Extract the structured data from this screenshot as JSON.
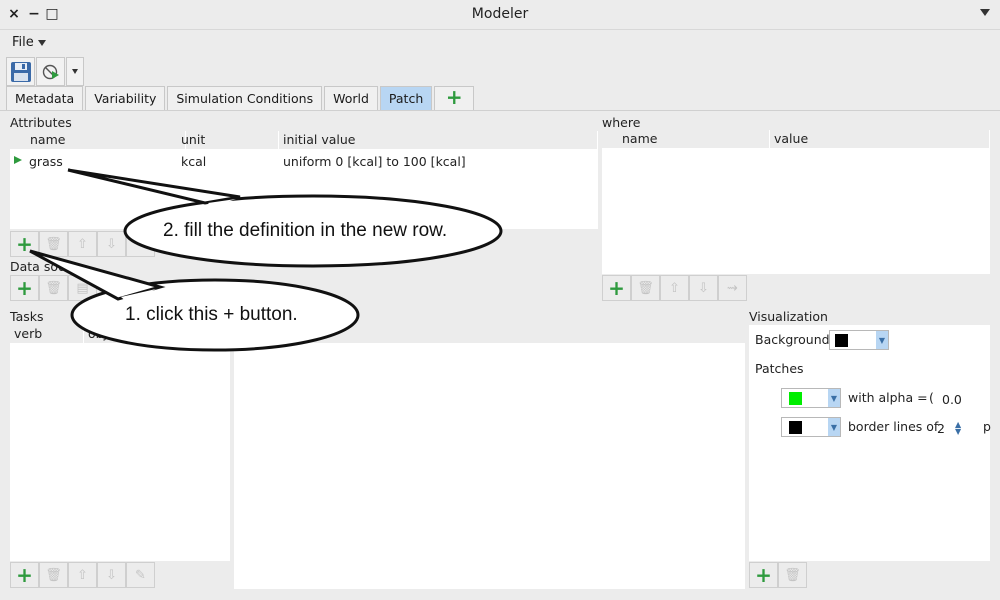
{
  "window": {
    "title": "Modeler",
    "close": "×",
    "minimize": "−",
    "maximize": "□"
  },
  "menu": {
    "file": "File"
  },
  "toolbar": {
    "save_icon": "floppy-disk-icon",
    "run_icon": "run-icon",
    "dropdown_icon": "chevron-down-icon"
  },
  "tabs": [
    {
      "label": "Metadata"
    },
    {
      "label": "Variability"
    },
    {
      "label": "Simulation Conditions"
    },
    {
      "label": "World"
    },
    {
      "label": "Patch",
      "active": true
    },
    {
      "label": "+"
    }
  ],
  "attributes": {
    "label": "Attributes",
    "columns": [
      "name",
      "unit",
      "initial value"
    ],
    "rows": [
      {
        "name": "grass",
        "unit": "kcal",
        "initial_value": "uniform 0 [kcal] to 100 [kcal]"
      }
    ]
  },
  "where": {
    "label": "where",
    "columns": [
      "name",
      "value"
    ]
  },
  "data_sources": {
    "label": "Data sou"
  },
  "tasks": {
    "label": "Tasks",
    "columns": [
      "verb",
      "obj"
    ]
  },
  "visualization": {
    "label": "Visualization",
    "background_label": "Background",
    "background_color": "#000000",
    "patches_label": "Patches",
    "patch_color": "#00ee00",
    "alpha_label": "with alpha =",
    "alpha_paren": "(",
    "alpha_value": "0.0",
    "border_color": "#000000",
    "border_label": "border lines of",
    "border_value": "2",
    "border_suffix": "p"
  },
  "callouts": {
    "step1": "1. click this + button.",
    "step2": "2. fill the definition in the new row."
  },
  "colors": {
    "accent": "#2e9a3e",
    "active_tab": "#b8d6f3"
  }
}
